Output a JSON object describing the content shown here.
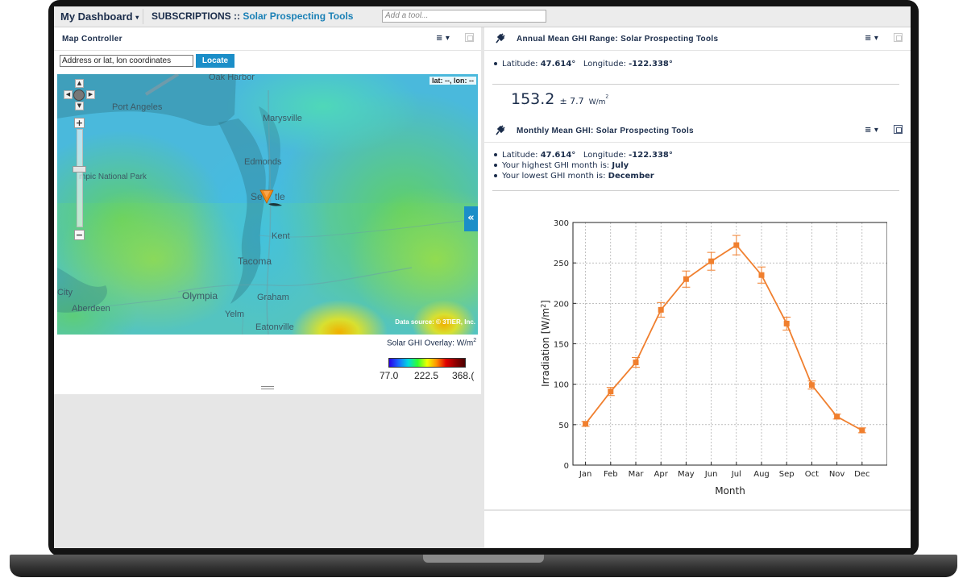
{
  "topbar": {
    "dashboard_label": "My Dashboard",
    "dashboard_caret": "▾",
    "crumb_prefix": "SUBSCRIPTIONS :: ",
    "crumb_app": "Solar Prospecting Tools",
    "add_tool_placeholder": "Add a tool..."
  },
  "map_panel": {
    "title": "Map Controller",
    "menu_icon": "≡ ▾",
    "address_placeholder": "Address or lat, lon coordinates",
    "locate_label": "Locate",
    "latlon_readout": "lat: --, lon: --",
    "data_source": "Data source: © 3TIER, Inc.",
    "place_labels": [
      "Oak Harbor",
      "Port Angeles",
      "Marysville",
      "Edmonds",
      "mpic National Park",
      "Se",
      "tle",
      "Kent",
      "Tacoma",
      "City",
      "Aberdeen",
      "Olympia",
      "Graham",
      "Yelm",
      "Eatonville"
    ],
    "legend": {
      "title": "Solar GHI Overlay: W/m",
      "title_sup": "2",
      "min": "77.0",
      "mid": "222.5",
      "max": "368.("
    },
    "colors": {
      "accent": "#1b8ec8",
      "marker": "#f08a1c"
    }
  },
  "annual_panel": {
    "title": "Annual Mean GHI Range: Solar Prospecting Tools",
    "menu_icon": "≡ ▾",
    "lat_label": "Latitude: ",
    "lat_value": "47.614°",
    "lon_label": "Longitude: ",
    "lon_value": "-122.338°",
    "value": "153.2",
    "plusminus": "± 7.7",
    "unit": "W/m",
    "unit_sup": "2"
  },
  "monthly_panel": {
    "title": "Monthly Mean GHI: Solar Prospecting Tools",
    "menu_icon": "≡ ▾",
    "lat_label": "Latitude: ",
    "lat_value": "47.614°",
    "lon_label": "Longitude: ",
    "lon_value": "-122.338°",
    "highest_label": "Your highest GHI month is: ",
    "highest_value": "July",
    "lowest_label": "Your lowest GHI month is: ",
    "lowest_value": "December"
  },
  "chart_data": {
    "type": "line",
    "categories": [
      "Jan",
      "Feb",
      "Mar",
      "Apr",
      "May",
      "Jun",
      "Jul",
      "Aug",
      "Sep",
      "Oct",
      "Nov",
      "Dec"
    ],
    "values": [
      51,
      91,
      127,
      192,
      230,
      252,
      272,
      235,
      175,
      99,
      60,
      43
    ],
    "errors": [
      3,
      5,
      6,
      9,
      10,
      11,
      12,
      10,
      8,
      5,
      3,
      3
    ],
    "xlabel": "Month",
    "ylabel": "Irradiation [W/m",
    "ylabel_sup": "2",
    "ylabel_close": "]",
    "ylim": [
      0,
      300
    ],
    "yticks": [
      "0",
      "50",
      "100",
      "150",
      "200",
      "250",
      "300"
    ],
    "grid": true,
    "color": "#f07f2e"
  }
}
